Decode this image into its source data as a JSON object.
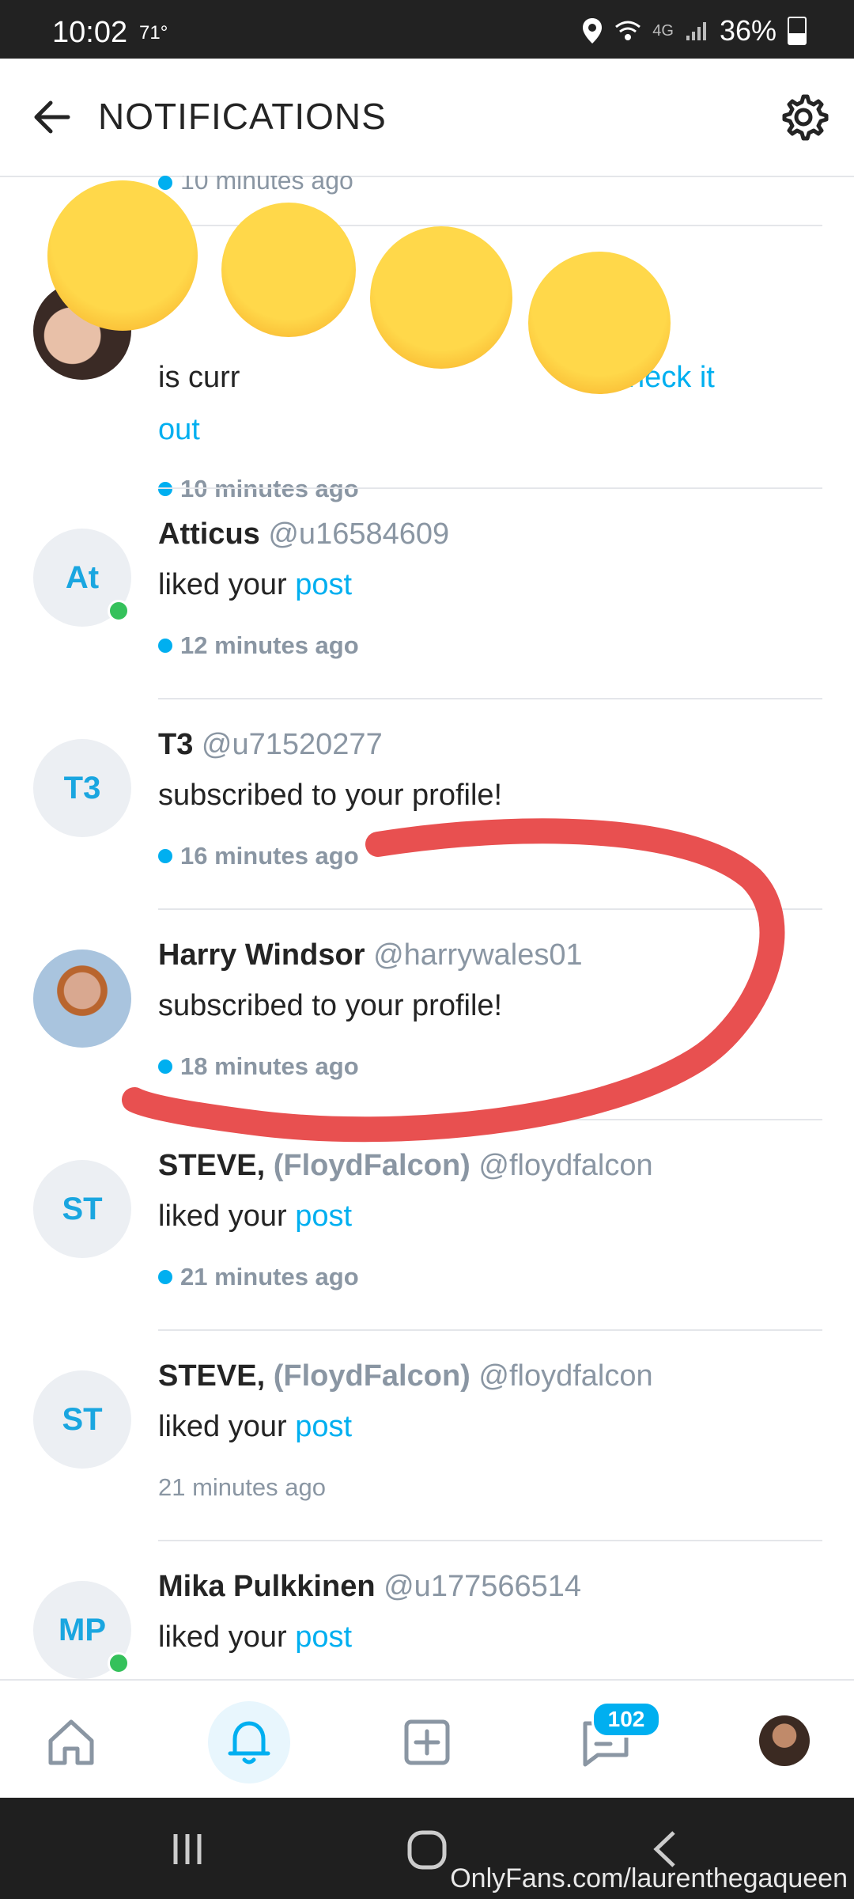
{
  "status_bar": {
    "time": "10:02",
    "temp": "71°",
    "network": "4G",
    "battery": "36%"
  },
  "header": {
    "title": "NOTIFICATIONS",
    "back_icon": "arrow-left-icon",
    "settings_icon": "gear-icon"
  },
  "partial_top_time": "10 minutes ago",
  "notifications": [
    {
      "text_prefix": "is cu",
      "text_mid": "rr",
      "link": "heck it",
      "link_cont": "out",
      "time": "10 minutes ago",
      "unread": true
    },
    {
      "name": "Atticus",
      "handle": "@u16584609",
      "initials": "At",
      "action": "liked your ",
      "link": "post",
      "time": "12 minutes ago",
      "unread": true,
      "online": true
    },
    {
      "name": "T3",
      "handle": "@u71520277",
      "initials": "T3",
      "action": "subscribed to your profile!",
      "time": "16 minutes ago",
      "unread": true,
      "online": false
    },
    {
      "name": "Harry Windsor",
      "handle": "@harrywales01",
      "action": "subscribed to your profile!",
      "time": "18 minutes ago",
      "unread": true
    },
    {
      "name": "STEVE,",
      "paren": "(FloydFalcon)",
      "handle": "@floydfalcon",
      "initials": "ST",
      "action": "liked your ",
      "link": "post",
      "time": "21 minutes ago",
      "unread": true
    },
    {
      "name": "STEVE,",
      "paren": "(FloydFalcon)",
      "handle": "@floydfalcon",
      "initials": "ST",
      "action": "liked your ",
      "link": "post",
      "time": "21 minutes ago",
      "unread": false
    },
    {
      "name": "Mika Pulkkinen",
      "handle": "@u177566514",
      "initials": "MP",
      "action": "liked your ",
      "link": "post",
      "online": true
    }
  ],
  "bottom_nav": {
    "messages_badge": "102"
  },
  "watermark": "OnlyFans.com/laurenthegaqueen",
  "colors": {
    "accent": "#00aff0",
    "online": "#35c15b",
    "scribble": "#e85050"
  }
}
